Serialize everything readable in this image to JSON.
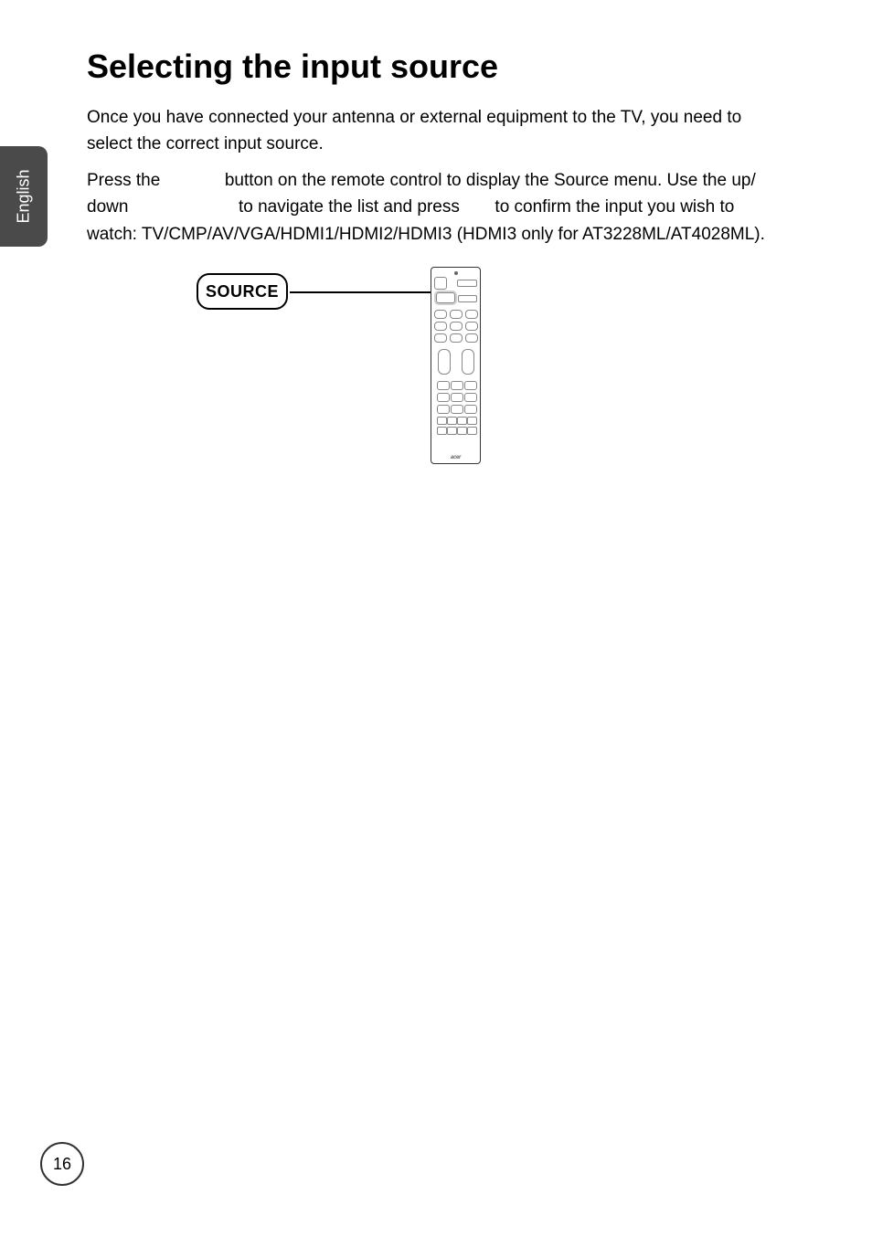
{
  "sideTab": {
    "language": "English"
  },
  "title": "Selecting the input source",
  "paragraphs": {
    "intro": "Once you have connected your antenna or external equipment to the TV, you need to select the correct input source.",
    "instr_part1": "Press the ",
    "instr_part2": " button on the remote control to display the Source menu. Use the up/ down ",
    "instr_part3": " to navigate the list and press ",
    "instr_part4": " to confirm the input you wish to watch: TV/CMP/AV/VGA/HDMI1/HDMI2/HDMI3 (HDMI3 only for AT3228ML/AT4028ML)."
  },
  "figure": {
    "callout_label": "SOURCE",
    "remote_brand": "acer"
  },
  "pageNumber": "16"
}
